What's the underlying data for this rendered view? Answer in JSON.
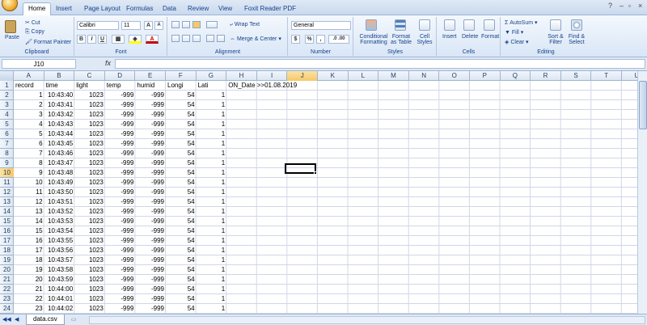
{
  "ribbon": {
    "tabs": [
      "Home",
      "Insert",
      "Page Layout",
      "Formulas",
      "Data",
      "Review",
      "View",
      "Foxit Reader PDF"
    ],
    "clipboard": {
      "paste": "Paste",
      "cut": "Cut",
      "copy": "Copy",
      "format_painter": "Format Painter",
      "label": "Clipboard"
    },
    "font": {
      "name": "Calibri",
      "size": "11",
      "bold": "B",
      "italic": "I",
      "underline": "U",
      "font_color": "A",
      "grow": "A",
      "shrink": "A",
      "label": "Font"
    },
    "alignment": {
      "wrap": "Wrap Text",
      "merge": "Merge & Center",
      "label": "Alignment"
    },
    "number": {
      "format": "General",
      "currency": "$",
      "percent": "%",
      "comma": ",",
      "inc_dec": ".0 .00",
      "label": "Number"
    },
    "styles": {
      "conditional": "Conditional",
      "conditional2": "Formatting",
      "format_table": "Format",
      "format_table2": "as Table",
      "cell_styles": "Cell",
      "cell_styles2": "Styles",
      "label": "Styles"
    },
    "cells": {
      "insert": "Insert",
      "delete": "Delete",
      "format": "Format",
      "label": "Cells"
    },
    "editing": {
      "autosum": "AutoSum",
      "fill": "Fill",
      "clear": "Clear",
      "sort": "Sort &",
      "sort2": "Filter",
      "find": "Find &",
      "find2": "Select",
      "label": "Editing"
    }
  },
  "formula_bar": {
    "name_box": "J10",
    "fx": "fx",
    "formula": ""
  },
  "columns": [
    "A",
    "B",
    "C",
    "D",
    "E",
    "F",
    "G",
    "H",
    "I",
    "J",
    "K",
    "L",
    "M",
    "N",
    "O",
    "P",
    "Q",
    "R",
    "S",
    "T",
    "U"
  ],
  "selected": {
    "col": "J",
    "row": "10"
  },
  "headers": [
    "record",
    "time",
    "light",
    "temp",
    "humid",
    "Longi",
    "Lati",
    "ON_Date >>01.08.2019"
  ],
  "rows": [
    [
      "1",
      "10:43:40",
      "1023",
      "-999",
      "-999",
      "54",
      "1"
    ],
    [
      "2",
      "10:43:41",
      "1023",
      "-999",
      "-999",
      "54",
      "1"
    ],
    [
      "3",
      "10:43:42",
      "1023",
      "-999",
      "-999",
      "54",
      "1"
    ],
    [
      "4",
      "10:43:43",
      "1023",
      "-999",
      "-999",
      "54",
      "1"
    ],
    [
      "5",
      "10:43:44",
      "1023",
      "-999",
      "-999",
      "54",
      "1"
    ],
    [
      "6",
      "10:43:45",
      "1023",
      "-999",
      "-999",
      "54",
      "1"
    ],
    [
      "7",
      "10:43:46",
      "1023",
      "-999",
      "-999",
      "54",
      "1"
    ],
    [
      "8",
      "10:43:47",
      "1023",
      "-999",
      "-999",
      "54",
      "1"
    ],
    [
      "9",
      "10:43:48",
      "1023",
      "-999",
      "-999",
      "54",
      "1"
    ],
    [
      "10",
      "10:43:49",
      "1023",
      "-999",
      "-999",
      "54",
      "1"
    ],
    [
      "11",
      "10:43:50",
      "1023",
      "-999",
      "-999",
      "54",
      "1"
    ],
    [
      "12",
      "10:43:51",
      "1023",
      "-999",
      "-999",
      "54",
      "1"
    ],
    [
      "13",
      "10:43:52",
      "1023",
      "-999",
      "-999",
      "54",
      "1"
    ],
    [
      "14",
      "10:43:53",
      "1023",
      "-999",
      "-999",
      "54",
      "1"
    ],
    [
      "15",
      "10:43:54",
      "1023",
      "-999",
      "-999",
      "54",
      "1"
    ],
    [
      "16",
      "10:43:55",
      "1023",
      "-999",
      "-999",
      "54",
      "1"
    ],
    [
      "17",
      "10:43:56",
      "1023",
      "-999",
      "-999",
      "54",
      "1"
    ],
    [
      "18",
      "10:43:57",
      "1023",
      "-999",
      "-999",
      "54",
      "1"
    ],
    [
      "19",
      "10:43:58",
      "1023",
      "-999",
      "-999",
      "54",
      "1"
    ],
    [
      "20",
      "10:43:59",
      "1023",
      "-999",
      "-999",
      "54",
      "1"
    ],
    [
      "21",
      "10:44:00",
      "1023",
      "-999",
      "-999",
      "54",
      "1"
    ],
    [
      "22",
      "10:44:01",
      "1023",
      "-999",
      "-999",
      "54",
      "1"
    ],
    [
      "23",
      "10:44:02",
      "1023",
      "-999",
      "-999",
      "54",
      "1"
    ],
    [
      "24",
      "10:44:03",
      "1023",
      "-999",
      "-999",
      "54",
      "1"
    ]
  ],
  "sheet_tab": "data.csv",
  "colors": {
    "accent": "#15428b",
    "selected_header": "#f7c76a",
    "gridline": "#d0d7e5"
  }
}
